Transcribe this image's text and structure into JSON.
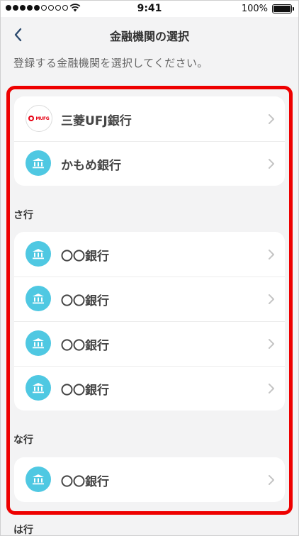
{
  "status_bar": {
    "time": "9:41",
    "battery": "100%"
  },
  "nav": {
    "back_icon": "chevron-left-icon",
    "title": "金融機関の選択"
  },
  "subtitle": "登録する金融機関を選択してください。",
  "logo": {
    "text": "MUFG"
  },
  "groups": [
    {
      "header": "",
      "items": [
        {
          "label": "三菱UFJ銀行",
          "icon": "mufg-logo"
        },
        {
          "label": "かもめ銀行",
          "icon": "bank-icon"
        }
      ]
    },
    {
      "header": "さ行",
      "items": [
        {
          "label": "〇〇銀行",
          "icon": "bank-icon"
        },
        {
          "label": "〇〇銀行",
          "icon": "bank-icon"
        },
        {
          "label": "〇〇銀行",
          "icon": "bank-icon"
        },
        {
          "label": "〇〇銀行",
          "icon": "bank-icon"
        }
      ]
    },
    {
      "header": "な行",
      "items": [
        {
          "label": "〇〇銀行",
          "icon": "bank-icon"
        }
      ]
    },
    {
      "header": "は行",
      "items": []
    }
  ],
  "colors": {
    "accent": "#4fc8e2",
    "highlight": "#ee0000",
    "mufg_red": "#e60012",
    "background": "#f3f3f4"
  }
}
